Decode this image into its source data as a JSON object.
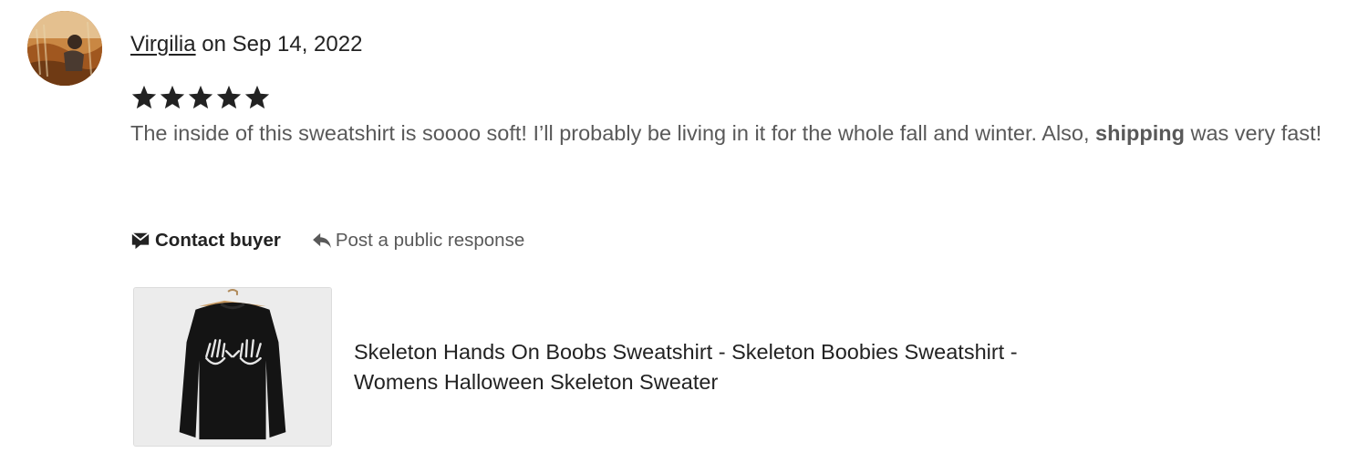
{
  "reviewer": {
    "name": "Virgilia",
    "date_text": " on Sep 14, 2022"
  },
  "rating": {
    "value": 5,
    "max": 5
  },
  "review": {
    "text_before": "The inside of this sweatshirt is soooo soft! I’ll probably be living in it for the whole fall and winter. Also, ",
    "highlight": "shipping",
    "text_after": " was very fast!"
  },
  "actions": {
    "contact_label": "Contact buyer",
    "respond_label": "Post a public response"
  },
  "listing": {
    "title": "Skeleton Hands On Boobs Sweatshirt - Skeleton Boobies Sweatshirt - Womens Halloween Skeleton Sweater"
  },
  "icons": {
    "contact": "message-icon",
    "respond": "reply-icon",
    "star": "star-icon"
  },
  "colors": {
    "text_primary": "#222222",
    "text_secondary": "#595959",
    "star": "#222222",
    "thumb_bg": "#ececec"
  }
}
